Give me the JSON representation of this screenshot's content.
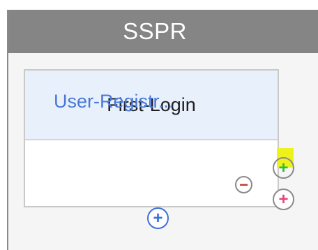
{
  "frame": {
    "title": "SSPR"
  },
  "stage": {
    "title": "First-Login",
    "step": {
      "label": "User-Registr...",
      "remove_symbol": "−",
      "add_below_symbol": "+"
    }
  },
  "side_controls": {
    "add_next_symbol": "+",
    "add_alt_symbol": "+"
  },
  "colors": {
    "header_bg": "#858585",
    "stage_header_bg": "#e7f0fb",
    "step_text": "#4a78d8",
    "highlight": "#eef21c",
    "add_green": "#2cbf2c",
    "add_pink": "#e7457a",
    "remove_red": "#c0392b"
  },
  "icons": {
    "remove": "minus-circle-icon",
    "add_below": "plus-circle-icon",
    "add_next": "plus-circle-icon",
    "add_alt": "plus-circle-icon"
  }
}
